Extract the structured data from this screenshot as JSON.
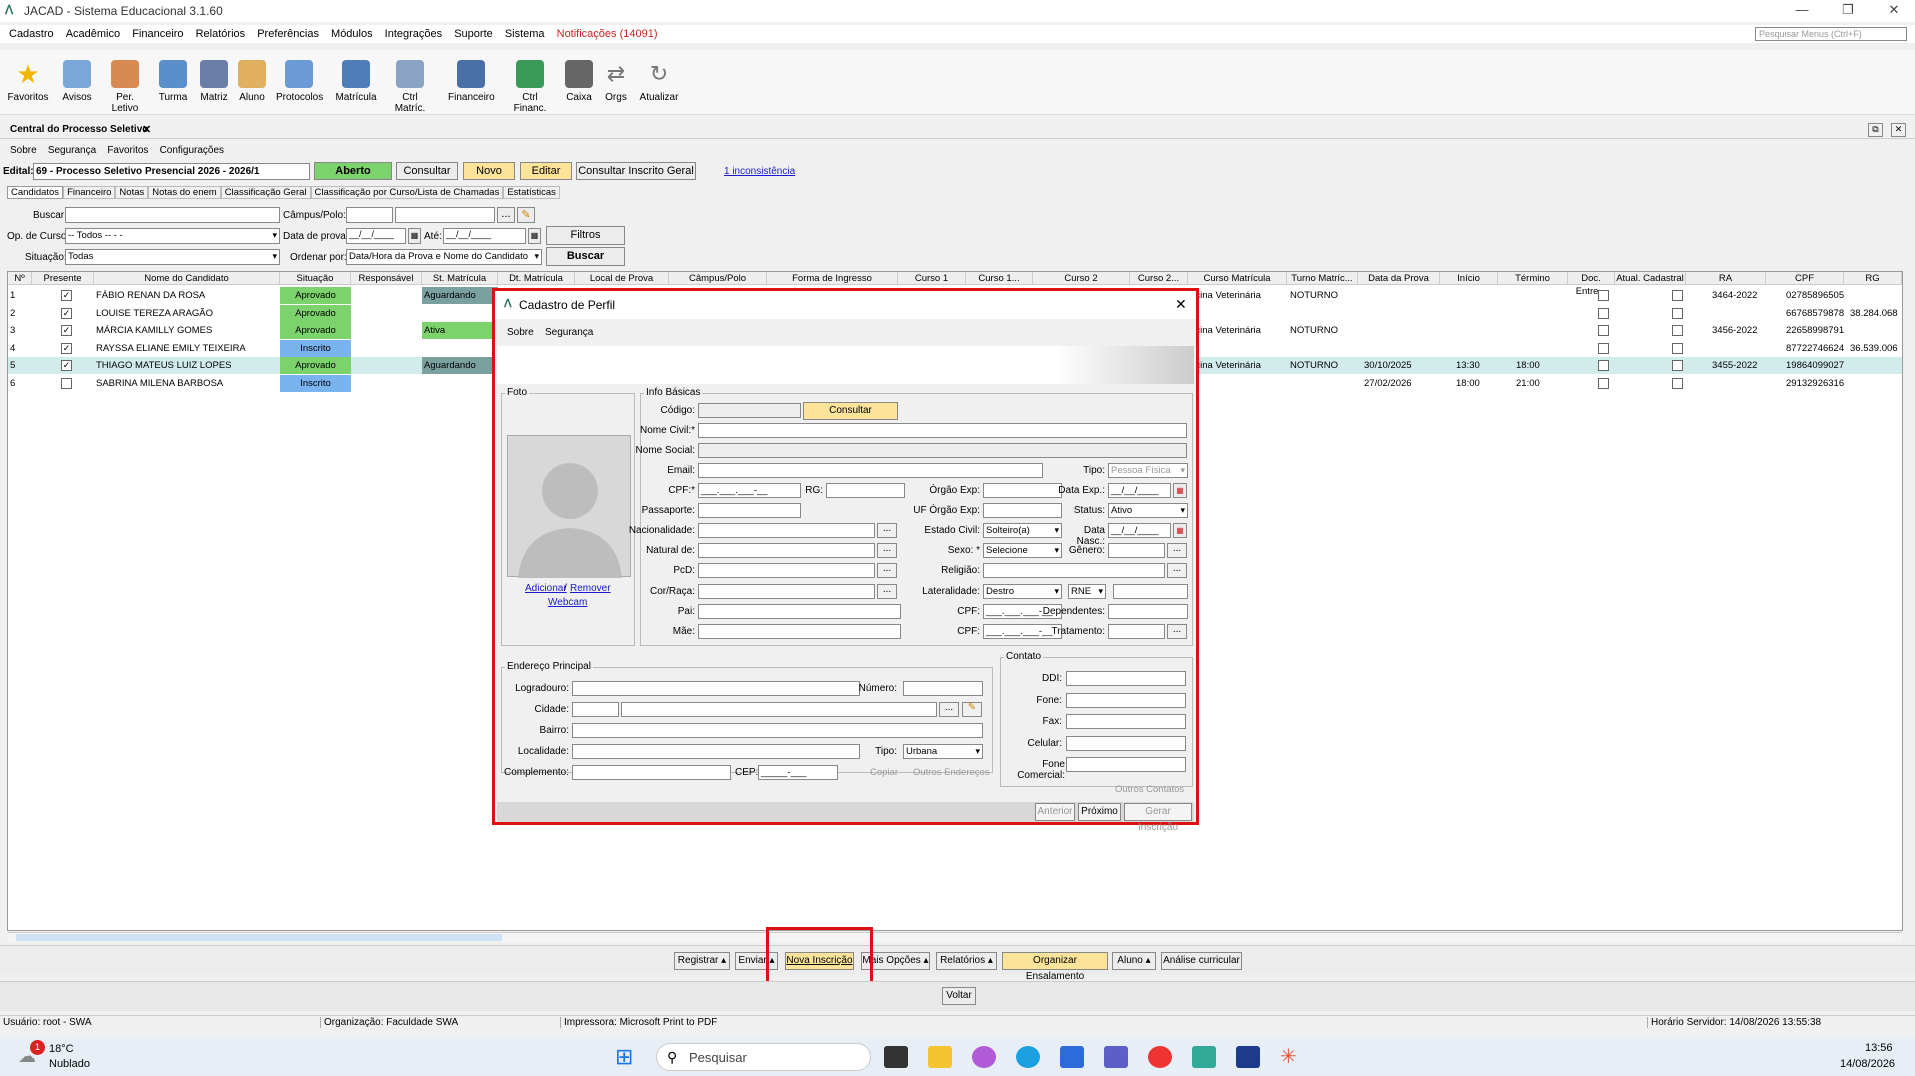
{
  "app": {
    "title": "JACAD - Sistema Educacional 3.1.60",
    "search_placeholder": "Pesquisar Menus (Ctrl+F)"
  },
  "menu": [
    "Cadastro",
    "Acadêmico",
    "Financeiro",
    "Relatórios",
    "Preferências",
    "Módulos",
    "Integrações",
    "Suporte",
    "Sistema"
  ],
  "notifications": "Notificações (14091)",
  "tools": [
    "Favoritos",
    "Avisos",
    "Per. Letivo",
    "Turma",
    "Matriz",
    "Aluno",
    "Protocolos",
    "Matrícula",
    "Ctrl Matríc.",
    "Financeiro",
    "Ctrl Financ.",
    "Caixa",
    "Orgs",
    "Atualizar"
  ],
  "doc_tab": "Central do Processo Seletivo",
  "submenu": [
    "Sobre",
    "Segurança",
    "Favoritos",
    "Configurações"
  ],
  "edital": {
    "label": "Edital:",
    "value": "69 - Processo Seletivo Presencial 2026 - 2026/1",
    "status": "Aberto",
    "consultar": "Consultar",
    "novo": "Novo",
    "editar": "Editar",
    "consultar_inscrito": "Consultar Inscrito Geral",
    "inconsistencia": "1 inconsistência"
  },
  "tabs": [
    "Candidatos",
    "Financeiro",
    "Notas",
    "Notas do enem",
    "Classificação Geral",
    "Classificação por Curso/Lista de Chamadas",
    "Estatísticas"
  ],
  "filters": {
    "buscar": "Buscar:",
    "campus": "Câmpus/Polo:",
    "op_curso": "Op. de Curso:",
    "op_curso_val": "-- Todos -- -  -",
    "data_prova": "Data de prova:",
    "date_ph": "__/__/____",
    "ate": "Até:",
    "filtros": "Filtros",
    "situacao": "Situação:",
    "situacao_val": "Todas",
    "ordenar": "Ordenar por:",
    "ordenar_val": "Data/Hora da Prova e Nome do Candidato",
    "buscar_btn": "Buscar"
  },
  "columns": [
    "Nº",
    "Presente",
    "Nome do Candidato",
    "Situação",
    "Responsável",
    "St. Matrícula",
    "Dt. Matrícula",
    "Local de Prova",
    "Câmpus/Polo",
    "Forma de Ingresso",
    "Curso 1",
    "Curso 1...",
    "Curso 2",
    "Curso 2...",
    "Curso Matrícula",
    "Turno Matríc...",
    "Data da Prova",
    "Início",
    "Término",
    "Doc. Entre...",
    "Atual. Cadastral",
    "RA",
    "CPF",
    "RG"
  ],
  "rows": [
    {
      "n": "1",
      "present": true,
      "name": "FÁBIO RENAN DA ROSA",
      "sit": "Aprovado",
      "stm": "Aguardando",
      "curso": "dicina Veterinária",
      "turno": "NOTURNO",
      "data": "",
      "ini": "",
      "fim": "",
      "ra": "3464-2022",
      "cpf": "02785896505",
      "rg": ""
    },
    {
      "n": "2",
      "present": true,
      "name": "LOUISE TEREZA ARAGÃO",
      "sit": "Aprovado",
      "stm": "",
      "curso": "",
      "turno": "",
      "data": "",
      "ini": "",
      "fim": "",
      "ra": "",
      "cpf": "66768579878",
      "rg": "38.284.068"
    },
    {
      "n": "3",
      "present": true,
      "name": "MÁRCIA KAMILLY GOMES",
      "sit": "Aprovado",
      "stm": "Ativa",
      "curso": "dicina Veterinária",
      "turno": "NOTURNO",
      "data": "",
      "ini": "",
      "fim": "",
      "ra": "3456-2022",
      "cpf": "22658998791",
      "rg": ""
    },
    {
      "n": "4",
      "present": true,
      "name": "RAYSSA ELIANE EMILY TEIXEIRA",
      "sit": "Inscrito",
      "stm": "",
      "curso": "",
      "turno": "",
      "data": "",
      "ini": "",
      "fim": "",
      "ra": "",
      "cpf": "87722746624",
      "rg": "36.539.006"
    },
    {
      "n": "5",
      "present": true,
      "name": "THIAGO MATEUS LUIZ LOPES",
      "sit": "Aprovado",
      "stm": "Aguardando",
      "curso": "dicina Veterinária",
      "turno": "NOTURNO",
      "data": "30/10/2025",
      "ini": "13:30",
      "fim": "18:00",
      "ra": "3455-2022",
      "cpf": "19864099027",
      "rg": ""
    },
    {
      "n": "6",
      "present": false,
      "name": "SABRINA MILENA BARBOSA",
      "sit": "Inscrito",
      "stm": "",
      "curso": "",
      "turno": "",
      "data": "27/02/2026",
      "ini": "18:00",
      "fim": "21:00",
      "ra": "",
      "cpf": "29132926316",
      "rg": ""
    }
  ],
  "bottom_buttons": [
    "Registrar",
    "Enviar",
    "Nova Inscrição",
    "Mais Opções",
    "Relatórios",
    "Organizar Ensalamento",
    "Aluno",
    "Análise curricular"
  ],
  "voltar": "Voltar",
  "statusbar": {
    "user": "Usuário: root - SWA",
    "org": "Organização: Faculdade SWA",
    "printer": "Impressora: Microsoft Print to PDF",
    "time": "Horário Servidor: 14/08/2026 13:55:38"
  },
  "taskbar": {
    "temp": "18°C",
    "weather": "Nublado",
    "search": "Pesquisar",
    "clock": "13:56",
    "date": "14/08/2026",
    "badge": "1"
  },
  "dialog": {
    "title": "Cadastro de Perfil",
    "menu": [
      "Sobre",
      "Segurança"
    ],
    "foto": "Foto",
    "adicionar": "Adicionar",
    "slash": "/",
    "remover": "Remover",
    "webcam": "Webcam",
    "info": "Info Básicas",
    "codigo": "Código:",
    "consultar": "Consultar",
    "nome_civil": "Nome Civil:*",
    "nome_social": "Nome Social:",
    "email": "Email:",
    "tipo": "Tipo:",
    "tipo_val": "Pessoa Física",
    "cpf": "CPF:*",
    "cpf_ph": "___.___.___-__",
    "rg": "RG:",
    "orgao": "Órgão Exp:",
    "data_exp": "Data Exp.:",
    "date_ph": "__/__/____",
    "passaporte": "Passaporte:",
    "uf_orgao": "UF Órgão Exp:",
    "status": "Status:",
    "status_val": "Ativo",
    "nacionalidade": "Nacionalidade:",
    "estado_civil": "Estado Civil:",
    "estado_civil_val": "Solteiro(a)",
    "data_nasc": "Data Nasc.:",
    "natural": "Natural de:",
    "sexo": "Sexo: *",
    "sexo_val": "Selecione",
    "genero": "Gênero:",
    "pcd": "PcD:",
    "religiao": "Religião:",
    "cor": "Cor/Raça:",
    "lateralidade": "Lateralidade:",
    "lateralidade_val": "Destro",
    "rne": "RNE",
    "pai": "Pai:",
    "cpf2": "CPF:",
    "dependentes": "Dependentes:",
    "mae": "Mãe:",
    "tratamento": "Tratamento:",
    "endereco": "Endereço Principal",
    "logradouro": "Logradouro:",
    "numero": "Número:",
    "cidade": "Cidade:",
    "bairro": "Bairro:",
    "localidade": "Localidade:",
    "tipo2": "Tipo:",
    "tipo2_val": "Urbana",
    "complemento": "Complemento:",
    "cep": "CEP:",
    "cep_ph": "_____-___",
    "copiar": "Copiar",
    "outros_end": "Outros Endereços",
    "contato": "Contato",
    "ddi": "DDI:",
    "fone": "Fone:",
    "fax": "Fax:",
    "celular": "Celular:",
    "fone_com": "Fone Comercial:",
    "outros_cont": "Outros Contatos",
    "anterior": "Anterior",
    "proximo": "Próximo",
    "gerar": "Gerar Inscrição"
  }
}
